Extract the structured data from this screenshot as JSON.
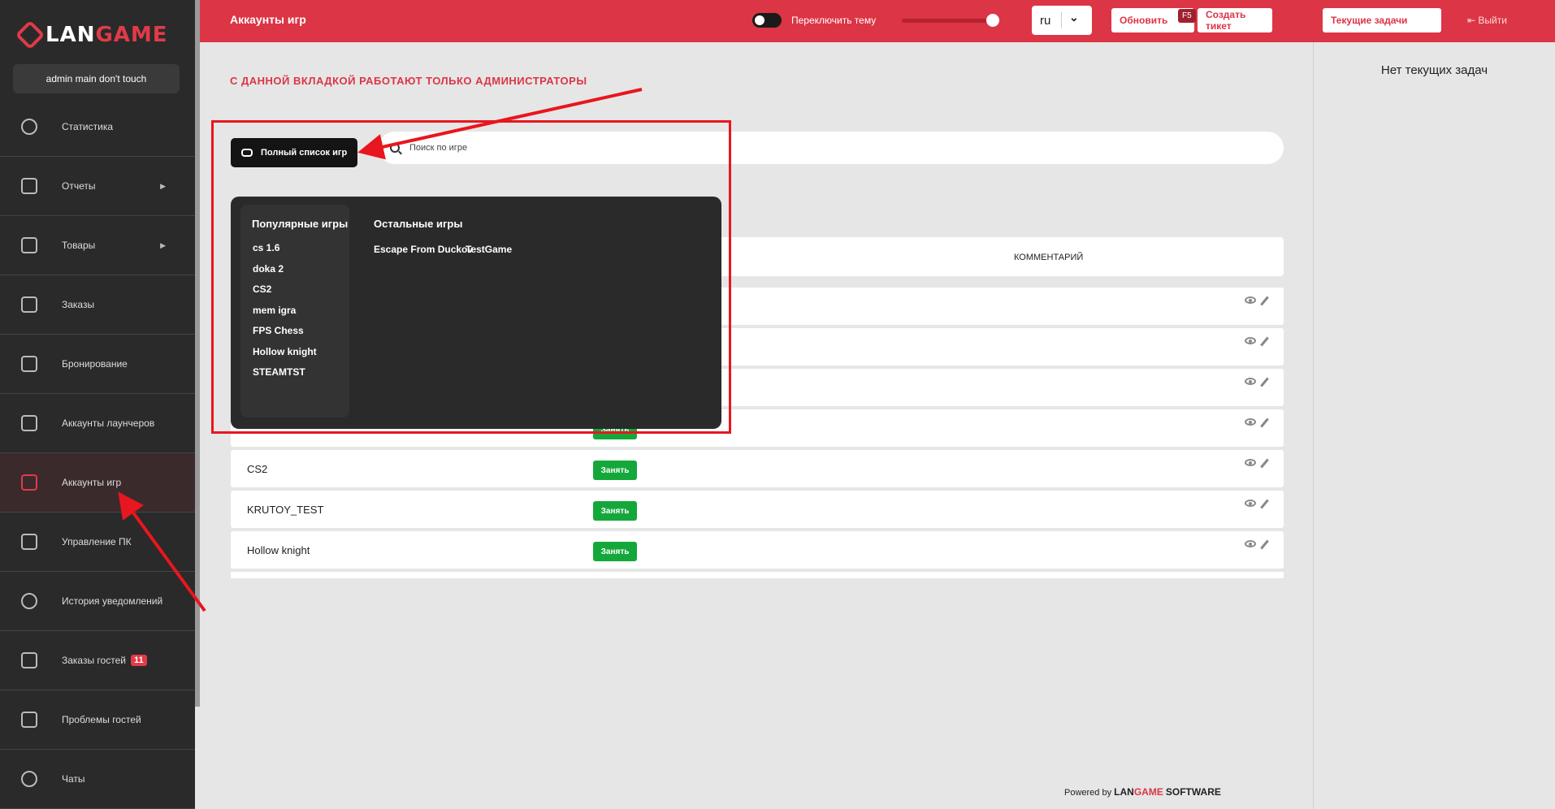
{
  "brand": {
    "logo_prefix": "LAN",
    "logo_suffix": "GAME"
  },
  "user": {
    "name": "admin main don't touch"
  },
  "sidebar": {
    "items": [
      {
        "label": "Статистика",
        "icon": "pie-chart-icon",
        "arrow": ""
      },
      {
        "label": "Отчеты",
        "icon": "report-icon",
        "arrow": "▶"
      },
      {
        "label": "Товары",
        "icon": "cloche-icon",
        "arrow": "▶"
      },
      {
        "label": "Заказы",
        "icon": "grid-icon",
        "arrow": ""
      },
      {
        "label": "Бронирование",
        "icon": "edit-square-icon",
        "arrow": ""
      },
      {
        "label": "Аккаунты лаунчеров",
        "icon": "account-box-icon",
        "arrow": ""
      },
      {
        "label": "Аккаунты игр",
        "icon": "account-box-icon",
        "arrow": ""
      },
      {
        "label": "Управление ПК",
        "icon": "monitor-icon",
        "arrow": ""
      },
      {
        "label": "История уведомлений",
        "icon": "bell-icon",
        "arrow": ""
      },
      {
        "label": "Заказы гостей",
        "icon": "cloche-icon",
        "arrow": "",
        "badge": "11"
      },
      {
        "label": "Проблемы гостей",
        "icon": "warning-icon",
        "arrow": ""
      },
      {
        "label": "Чаты",
        "icon": "chat-icon",
        "arrow": ""
      }
    ]
  },
  "topbar": {
    "title": "Аккаунты игр",
    "theme_label": "Переключить тему",
    "language": "ru",
    "refresh_label": "Обновить",
    "refresh_hotkey": "F5",
    "ticket_label": "Создать тикет",
    "tasks_label": "Текущие задачи",
    "logout_label": "Выйти"
  },
  "right_panel": {
    "empty_text": "Нет текущих задач"
  },
  "main": {
    "admin_note": "С ДАННОЙ ВКЛАДКОЙ РАБОТАЮТ ТОЛЬКО АДМИНИСТРАТОРЫ",
    "full_list_label": "Полный список игр",
    "search_placeholder": "Поиск по игре",
    "comment_header": "КОММЕНТАРИЙ",
    "take_label": "Занять",
    "rows": [
      {
        "name": ""
      },
      {
        "name": ""
      },
      {
        "name": ""
      },
      {
        "name": ""
      },
      {
        "name": "CS2"
      },
      {
        "name": "KRUTOY_TEST"
      },
      {
        "name": "Hollow knight"
      }
    ]
  },
  "dropdown": {
    "popular_heading": "Популярные игры",
    "other_heading": "Остальные игры",
    "popular": [
      "cs 1.6",
      "doka 2",
      "CS2",
      "mem igra",
      "FPS Chess",
      "Hollow knight",
      "STEAMTST"
    ],
    "other": [
      "Escape From Duckov",
      "TestGame"
    ]
  },
  "footer": {
    "powered_by": "Powered by",
    "brand_a": "LAN",
    "brand_b": "GAME",
    "brand_c": "SOFTWARE"
  },
  "colors": {
    "accent": "#dc3545",
    "sidebar_bg": "#2a2a2a",
    "take_button": "#14a83b",
    "annotation": "#e8161e"
  }
}
